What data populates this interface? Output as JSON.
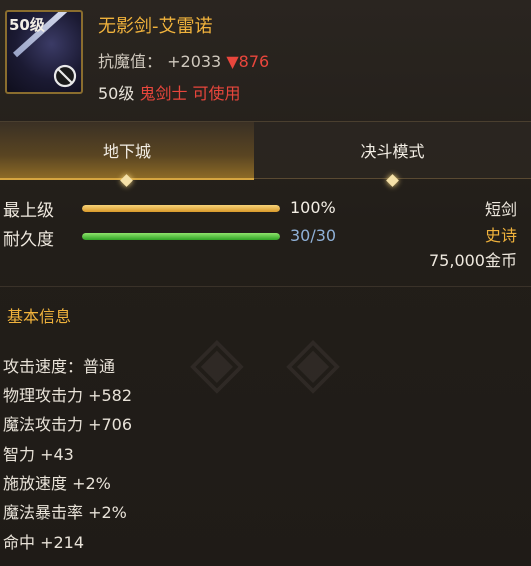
{
  "item": {
    "icon_level": "50级",
    "name": "无影剑-艾雷诺",
    "anti_magic_label": "抗魔值：",
    "anti_magic_value": "+2033",
    "anti_magic_diff": "▼876",
    "level_req": "50级",
    "class_req": "鬼剑士 可使用"
  },
  "tabs": [
    {
      "label": "地下城",
      "active": true
    },
    {
      "label": "决斗模式",
      "active": false
    }
  ],
  "bars": {
    "grade": {
      "label": "最上级",
      "value_text": "100%",
      "fill": 1.0,
      "color": "#f0b23c"
    },
    "durability": {
      "label": "耐久度",
      "value_text": "30/30",
      "fill": 1.0,
      "color": "#8fb0d6"
    }
  },
  "meta": {
    "weapon_type": "短剑",
    "rarity": "史诗",
    "rarity_color": "#f0b23c",
    "price": "75,000金币"
  },
  "basic_info": {
    "title": "基本信息",
    "attrs": [
      "攻击速度：普通",
      "物理攻击力 +582",
      "魔法攻击力 +706",
      "智力 +43",
      "施放速度 +2%",
      "魔法暴击率 +2%",
      "命中 +214"
    ]
  },
  "icons": {
    "item_icon": "sword-icon",
    "no_use_icon": "prohibited-icon"
  }
}
